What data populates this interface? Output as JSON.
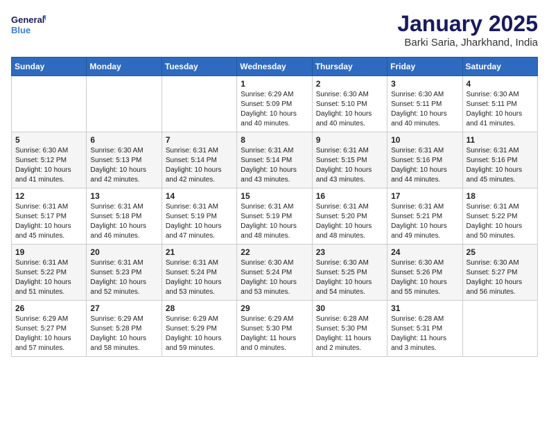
{
  "header": {
    "logo_general": "General",
    "logo_blue": "Blue",
    "month": "January 2025",
    "location": "Barki Saria, Jharkhand, India"
  },
  "weekdays": [
    "Sunday",
    "Monday",
    "Tuesday",
    "Wednesday",
    "Thursday",
    "Friday",
    "Saturday"
  ],
  "weeks": [
    [
      {
        "day": "",
        "info": ""
      },
      {
        "day": "",
        "info": ""
      },
      {
        "day": "",
        "info": ""
      },
      {
        "day": "1",
        "info": "Sunrise: 6:29 AM\nSunset: 5:09 PM\nDaylight: 10 hours\nand 40 minutes."
      },
      {
        "day": "2",
        "info": "Sunrise: 6:30 AM\nSunset: 5:10 PM\nDaylight: 10 hours\nand 40 minutes."
      },
      {
        "day": "3",
        "info": "Sunrise: 6:30 AM\nSunset: 5:11 PM\nDaylight: 10 hours\nand 40 minutes."
      },
      {
        "day": "4",
        "info": "Sunrise: 6:30 AM\nSunset: 5:11 PM\nDaylight: 10 hours\nand 41 minutes."
      }
    ],
    [
      {
        "day": "5",
        "info": "Sunrise: 6:30 AM\nSunset: 5:12 PM\nDaylight: 10 hours\nand 41 minutes."
      },
      {
        "day": "6",
        "info": "Sunrise: 6:30 AM\nSunset: 5:13 PM\nDaylight: 10 hours\nand 42 minutes."
      },
      {
        "day": "7",
        "info": "Sunrise: 6:31 AM\nSunset: 5:14 PM\nDaylight: 10 hours\nand 42 minutes."
      },
      {
        "day": "8",
        "info": "Sunrise: 6:31 AM\nSunset: 5:14 PM\nDaylight: 10 hours\nand 43 minutes."
      },
      {
        "day": "9",
        "info": "Sunrise: 6:31 AM\nSunset: 5:15 PM\nDaylight: 10 hours\nand 43 minutes."
      },
      {
        "day": "10",
        "info": "Sunrise: 6:31 AM\nSunset: 5:16 PM\nDaylight: 10 hours\nand 44 minutes."
      },
      {
        "day": "11",
        "info": "Sunrise: 6:31 AM\nSunset: 5:16 PM\nDaylight: 10 hours\nand 45 minutes."
      }
    ],
    [
      {
        "day": "12",
        "info": "Sunrise: 6:31 AM\nSunset: 5:17 PM\nDaylight: 10 hours\nand 45 minutes."
      },
      {
        "day": "13",
        "info": "Sunrise: 6:31 AM\nSunset: 5:18 PM\nDaylight: 10 hours\nand 46 minutes."
      },
      {
        "day": "14",
        "info": "Sunrise: 6:31 AM\nSunset: 5:19 PM\nDaylight: 10 hours\nand 47 minutes."
      },
      {
        "day": "15",
        "info": "Sunrise: 6:31 AM\nSunset: 5:19 PM\nDaylight: 10 hours\nand 48 minutes."
      },
      {
        "day": "16",
        "info": "Sunrise: 6:31 AM\nSunset: 5:20 PM\nDaylight: 10 hours\nand 48 minutes."
      },
      {
        "day": "17",
        "info": "Sunrise: 6:31 AM\nSunset: 5:21 PM\nDaylight: 10 hours\nand 49 minutes."
      },
      {
        "day": "18",
        "info": "Sunrise: 6:31 AM\nSunset: 5:22 PM\nDaylight: 10 hours\nand 50 minutes."
      }
    ],
    [
      {
        "day": "19",
        "info": "Sunrise: 6:31 AM\nSunset: 5:22 PM\nDaylight: 10 hours\nand 51 minutes."
      },
      {
        "day": "20",
        "info": "Sunrise: 6:31 AM\nSunset: 5:23 PM\nDaylight: 10 hours\nand 52 minutes."
      },
      {
        "day": "21",
        "info": "Sunrise: 6:31 AM\nSunset: 5:24 PM\nDaylight: 10 hours\nand 53 minutes."
      },
      {
        "day": "22",
        "info": "Sunrise: 6:30 AM\nSunset: 5:24 PM\nDaylight: 10 hours\nand 53 minutes."
      },
      {
        "day": "23",
        "info": "Sunrise: 6:30 AM\nSunset: 5:25 PM\nDaylight: 10 hours\nand 54 minutes."
      },
      {
        "day": "24",
        "info": "Sunrise: 6:30 AM\nSunset: 5:26 PM\nDaylight: 10 hours\nand 55 minutes."
      },
      {
        "day": "25",
        "info": "Sunrise: 6:30 AM\nSunset: 5:27 PM\nDaylight: 10 hours\nand 56 minutes."
      }
    ],
    [
      {
        "day": "26",
        "info": "Sunrise: 6:29 AM\nSunset: 5:27 PM\nDaylight: 10 hours\nand 57 minutes."
      },
      {
        "day": "27",
        "info": "Sunrise: 6:29 AM\nSunset: 5:28 PM\nDaylight: 10 hours\nand 58 minutes."
      },
      {
        "day": "28",
        "info": "Sunrise: 6:29 AM\nSunset: 5:29 PM\nDaylight: 10 hours\nand 59 minutes."
      },
      {
        "day": "29",
        "info": "Sunrise: 6:29 AM\nSunset: 5:30 PM\nDaylight: 11 hours\nand 0 minutes."
      },
      {
        "day": "30",
        "info": "Sunrise: 6:28 AM\nSunset: 5:30 PM\nDaylight: 11 hours\nand 2 minutes."
      },
      {
        "day": "31",
        "info": "Sunrise: 6:28 AM\nSunset: 5:31 PM\nDaylight: 11 hours\nand 3 minutes."
      },
      {
        "day": "",
        "info": ""
      }
    ]
  ]
}
